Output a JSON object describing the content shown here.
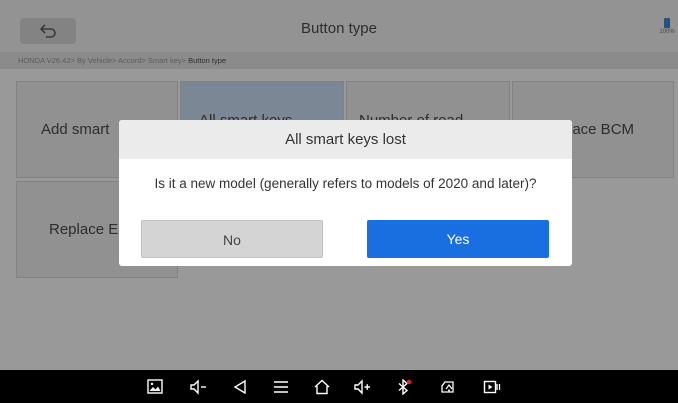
{
  "header": {
    "title": "Button type",
    "back_icon": "back-arrow-icon",
    "battery_percent": "100%",
    "battery_color": "#3a78c2"
  },
  "breadcrumb": {
    "path": "HONDA V26.42> By Vehicle> Accord> Smart key>",
    "current": " Button type"
  },
  "tiles": [
    {
      "label": "Add smart",
      "selected": false
    },
    {
      "label": "All smart keys",
      "selected": true
    },
    {
      "label": "Number of read",
      "selected": false
    },
    {
      "label": "lace BCM",
      "selected": false
    },
    {
      "label": "Replace E",
      "selected": false
    }
  ],
  "dialog": {
    "title": "All smart keys lost",
    "message": "Is it a new model (generally refers to models of 2020 and later)?",
    "no_label": "No",
    "yes_label": "Yes",
    "accent_color": "#1a6fe0"
  },
  "navbar": {
    "icons": [
      "screenshot-icon",
      "volume-down-icon",
      "back-icon",
      "menu-icon",
      "home-icon",
      "volume-up-icon",
      "bluetooth-icon",
      "vci-icon",
      "screen-record-icon"
    ]
  }
}
